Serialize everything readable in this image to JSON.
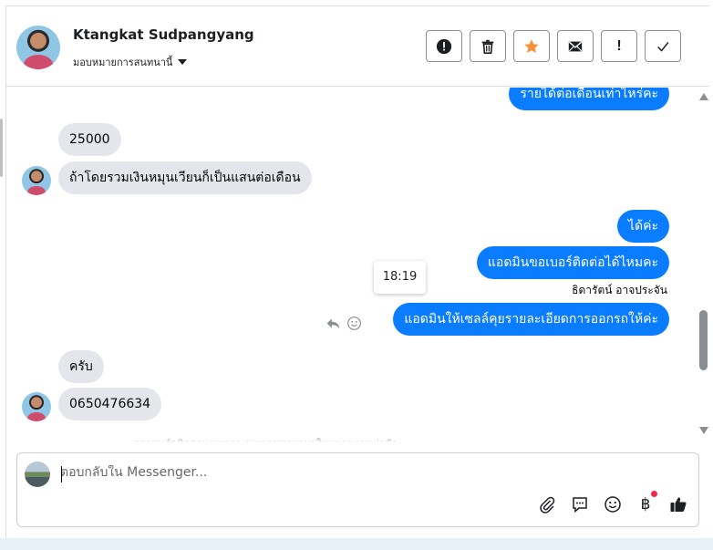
{
  "contact": {
    "name": "Ktangkat Sudpangyang",
    "assign_label": "มอบหมายการสนทนานี้"
  },
  "toolbar": {
    "buttons": [
      {
        "icon": "alert-circle-icon"
      },
      {
        "icon": "trash-icon"
      },
      {
        "icon": "star-icon",
        "color": "#f7923b"
      },
      {
        "icon": "envelope-icon"
      },
      {
        "icon": "exclamation-icon",
        "glyph": "!"
      },
      {
        "icon": "check-icon"
      }
    ]
  },
  "messages": {
    "m0": "รายได้ต่อเดือนเท่าไหร่คะ",
    "m1": "25000",
    "m2": "ถ้าโดยรวมเงินหมุนเวียนก็เป็นแสนต่อเดือน",
    "m3": "ได้ค่ะ",
    "m4": "แอดมินขอเบอร์ติดต่อได้ไหมคะ",
    "m5": "แอดมินให้เซลล์คุยรายละเอียดการออกรถให้ค่ะ",
    "m6": "ครับ",
    "m7": "0650476634"
  },
  "tooltip_time": "18:19",
  "sender_name": "ธิดารัตน์ อาจประจัน",
  "composer": {
    "placeholder": "ตอบกลับใน Messenger...",
    "currency_symbol": "฿"
  },
  "colors": {
    "outgoing_bubble": "#0a7cff",
    "incoming_bubble": "#e4e6eb",
    "star": "#f7923b",
    "notification_dot": "#f02849"
  }
}
